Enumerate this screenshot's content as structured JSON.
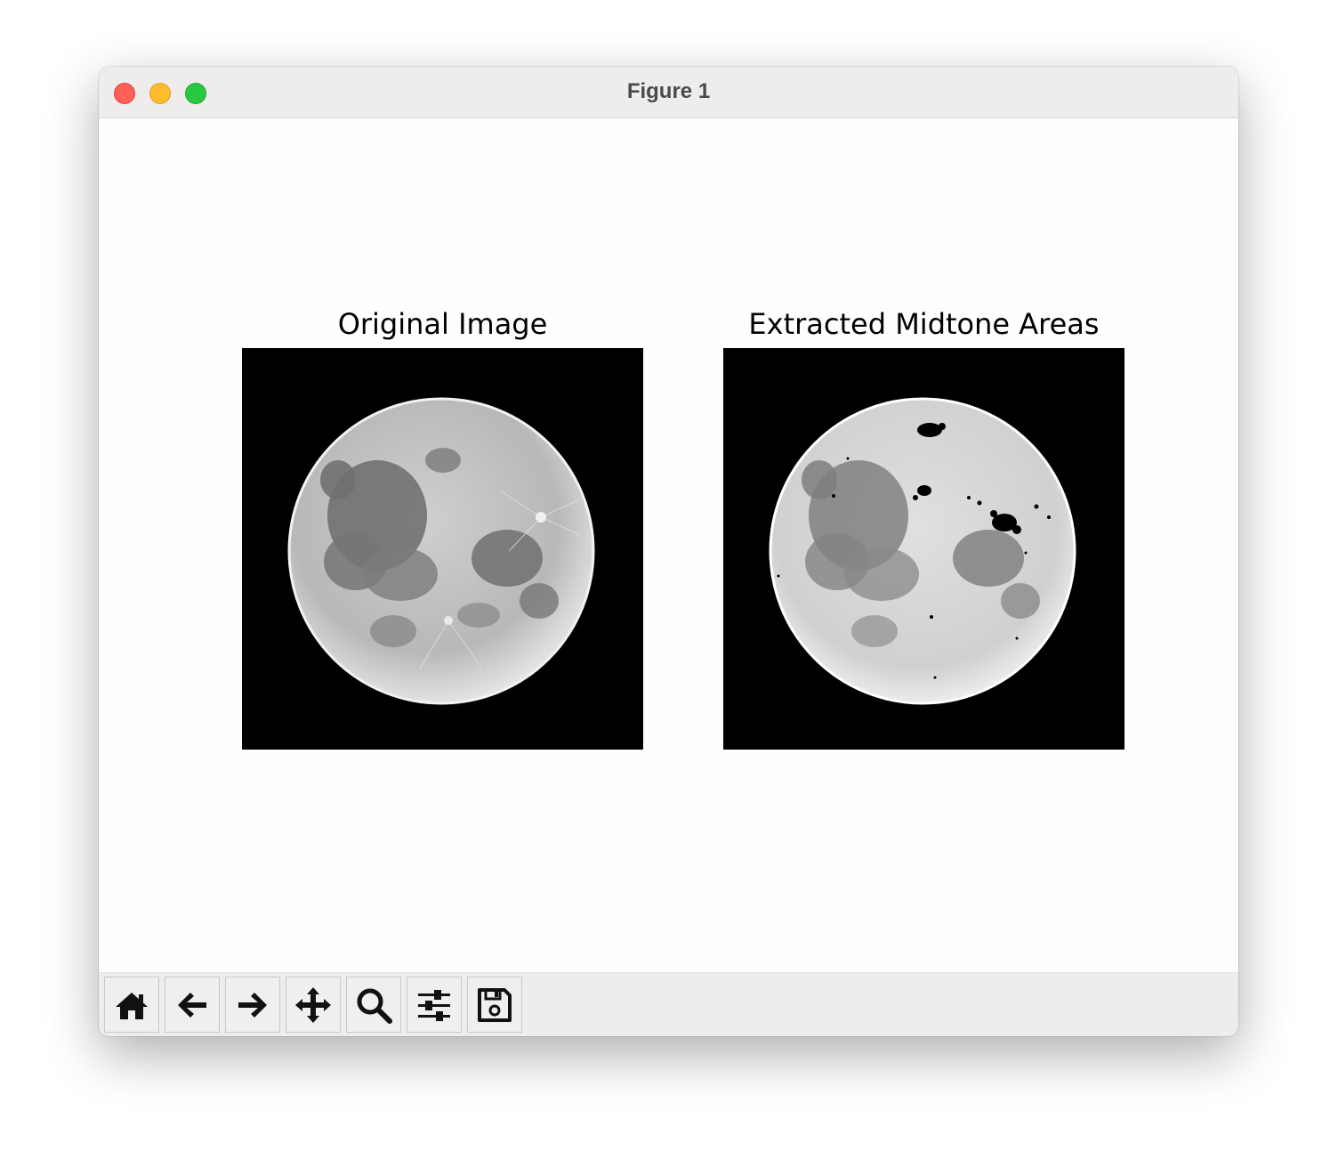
{
  "window": {
    "title": "Figure 1"
  },
  "figure": {
    "axes": [
      {
        "title": "Original Image"
      },
      {
        "title": "Extracted Midtone Areas"
      }
    ]
  },
  "toolbar": {
    "buttons": [
      {
        "name": "home",
        "icon": "home-icon"
      },
      {
        "name": "back",
        "icon": "arrow-left-icon"
      },
      {
        "name": "forward",
        "icon": "arrow-right-icon"
      },
      {
        "name": "pan",
        "icon": "move-icon"
      },
      {
        "name": "zoom",
        "icon": "search-icon"
      },
      {
        "name": "configure-subplots",
        "icon": "sliders-icon"
      },
      {
        "name": "save",
        "icon": "floppy-disk-icon"
      }
    ]
  },
  "colors": {
    "close": "#fe5f57",
    "minimize": "#febc2e",
    "maximize": "#28c840",
    "image_background": "#000000"
  }
}
